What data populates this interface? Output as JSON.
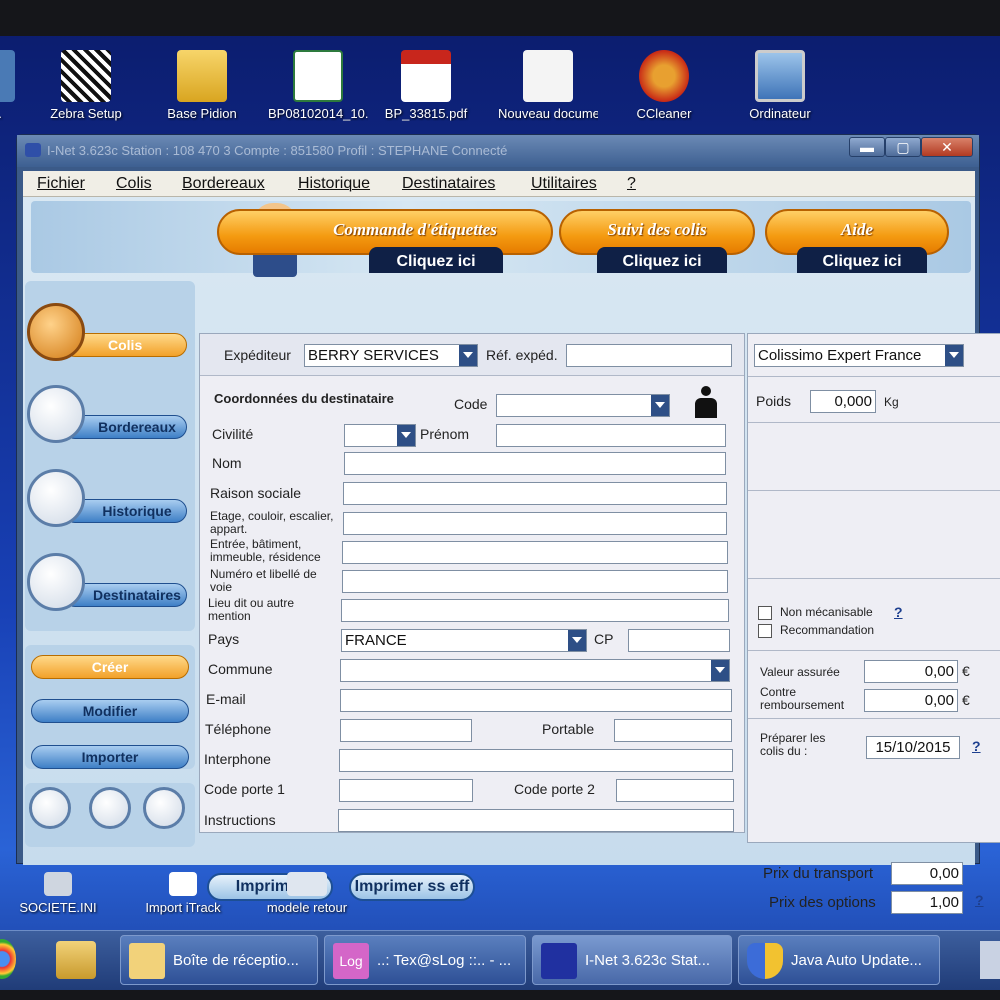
{
  "desktop": {
    "icons": [
      {
        "label": "B-...",
        "icon": "app-icon"
      },
      {
        "label": "Zebra Setup",
        "icon": "zebra-icon"
      },
      {
        "label": "Base Pidion",
        "icon": "folder-icon"
      },
      {
        "label": "BP08102014_10...",
        "icon": "excel-icon"
      },
      {
        "label": "BP_33815.pdf",
        "icon": "pdf-icon"
      },
      {
        "label": "Nouveau document",
        "icon": "text-file-icon"
      },
      {
        "label": "CCleaner",
        "icon": "ccleaner-icon"
      },
      {
        "label": "Ordinateur",
        "icon": "computer-icon"
      }
    ],
    "bottom_icons": [
      {
        "label": "SOCIETE.INI",
        "icon": "ini-file-icon"
      },
      {
        "label": "Import iTrack",
        "icon": "shortcut-icon"
      },
      {
        "label": "modele retour",
        "icon": "document-icon"
      }
    ]
  },
  "window": {
    "title": "I-Net 3.623c   Station : 108 470 3   Compte : 851580   Profil : STEPHANE   Connecté",
    "controls": {
      "minimize": "▬",
      "maximize": "▢",
      "close": "✕"
    }
  },
  "menu": [
    "Fichier",
    "Colis",
    "Bordereaux",
    "Historique",
    "Destinataires",
    "Utilitaires",
    "?"
  ],
  "banner": {
    "buttons": [
      {
        "title": "Commande d'étiquettes",
        "sub": "Cliquez ici"
      },
      {
        "title": "Suivi des colis",
        "sub": "Cliquez ici"
      },
      {
        "title": "Aide",
        "sub": "Cliquez ici"
      }
    ]
  },
  "leftnav": {
    "items": [
      "Colis",
      "Bordereaux",
      "Historique",
      "Destinataires"
    ],
    "actions": [
      "Créer",
      "Modifier",
      "Importer"
    ]
  },
  "form": {
    "expediteur_label": "Expéditeur",
    "expediteur_value": "BERRY SERVICES",
    "ref_label": "Réf. expéd.",
    "ref_value": "",
    "section_title": "Coordonnées du destinataire",
    "code_label": "Code",
    "civilite_label": "Civilité",
    "prenom_label": "Prénom",
    "nom_label": "Nom",
    "raison_label": "Raison sociale",
    "etage_label": "Etage, couloir, escalier, appart.",
    "entree_label": "Entrée, bâtiment, immeuble, résidence",
    "numero_label": "Numéro et libellé de voie",
    "lieu_label": "Lieu dit ou autre mention",
    "pays_label": "Pays",
    "pays_value": "FRANCE",
    "cp_label": "CP",
    "commune_label": "Commune",
    "email_label": "E-mail",
    "tel_label": "Téléphone",
    "portable_label": "Portable",
    "interphone_label": "Interphone",
    "code1_label": "Code porte 1",
    "code2_label": "Code porte 2",
    "instructions_label": "Instructions"
  },
  "right": {
    "service_value": "Colissimo Expert France",
    "poids_label": "Poids",
    "poids_value": "0,000",
    "poids_unit": "Kg",
    "non_meca_label": "Non mécanisable",
    "recommandation_label": "Recommandation",
    "help": "?",
    "valeur_label": "Valeur assurée",
    "valeur_value": "0,00",
    "contre_label": "Contre remboursement",
    "contre_value": "0,00",
    "euro": "€",
    "preparer_label": "Préparer les colis du :",
    "date_value": "15/10/2015"
  },
  "bottom": {
    "imprimer": "Imprimer",
    "imprimer_ss": "Imprimer ss eff",
    "prix_transport_label": "Prix du transport",
    "prix_transport_value": "0,00",
    "prix_options_label": "Prix des options",
    "prix_options_value": "1,00"
  },
  "taskbar": {
    "items": [
      {
        "label": "Boîte de réceptio...",
        "icon": "outlook-icon"
      },
      {
        "label": "..: Tex@sLog ::.. - ...",
        "icon": "texslog-icon",
        "icon_text": "Log"
      },
      {
        "label": "I-Net 3.623c   Stat...",
        "icon": "inet-icon"
      },
      {
        "label": "Java Auto Update...",
        "icon": "shield-icon"
      }
    ]
  }
}
